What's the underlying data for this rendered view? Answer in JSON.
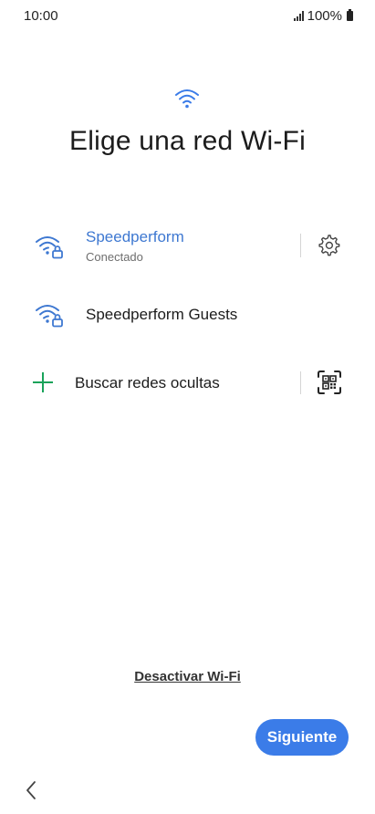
{
  "status": {
    "time": "10:00",
    "battery": "100%"
  },
  "title": "Elige una red Wi-Fi",
  "networks": [
    {
      "name": "Speedperform",
      "status": "Conectado",
      "icon": "wifi-lock-icon",
      "connected": true
    },
    {
      "name": "Speedperform Guests",
      "status": "",
      "icon": "wifi-lock-icon",
      "connected": false
    }
  ],
  "hidden_networks": {
    "label": "Buscar redes ocultas",
    "icon": "plus-icon",
    "qr_icon": "qr-scan-icon"
  },
  "disable_wifi_label": "Desactivar Wi-Fi",
  "next_label": "Siguiente",
  "colors": {
    "accent": "#3b7ce8",
    "connected_text": "#3e78d1",
    "plus_green": "#19a35a"
  }
}
